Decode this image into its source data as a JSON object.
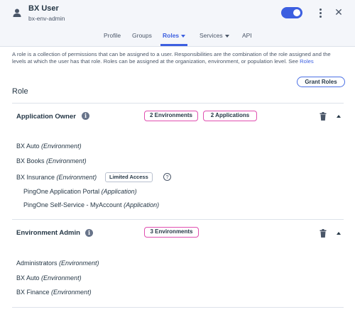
{
  "header": {
    "user_name": "BX User",
    "user_sub": "bx-env-admin",
    "enabled": true
  },
  "tabs": [
    {
      "label": "Profile",
      "active": false,
      "dropdown": false
    },
    {
      "label": "Groups",
      "active": false,
      "dropdown": false
    },
    {
      "label": "Roles",
      "active": true,
      "dropdown": true
    },
    {
      "label": "Services",
      "active": false,
      "dropdown": true
    },
    {
      "label": "API",
      "active": false,
      "dropdown": false
    }
  ],
  "description": {
    "text": "A role is a collection of permissions that can be assigned to a user. Responsibilities are the combination of the role assigned and the levels at which the user has that role. Roles can be assigned at the organization, environment, or population level. See ",
    "link": "Roles"
  },
  "grant_roles_label": "Grant Roles",
  "section_title": "Role",
  "roles": [
    {
      "name": "Application Owner",
      "badges": [
        "2 Environments",
        "2 Applications"
      ],
      "items": [
        {
          "name": "BX Auto",
          "scope": "(Environment)"
        },
        {
          "name": "BX Books",
          "scope": "(Environment)"
        },
        {
          "name": "BX Insurance",
          "scope": "(Environment)",
          "tag": "Limited Access"
        },
        {
          "name": "PingOne Application Portal",
          "scope": "(Application)"
        },
        {
          "name": "PingOne Self-Service - MyAccount",
          "scope": "(Application)"
        }
      ]
    },
    {
      "name": "Environment Admin",
      "badges": [
        "3 Environments"
      ],
      "items": [
        {
          "name": "Administrators",
          "scope": "(Environment)"
        },
        {
          "name": "BX Auto",
          "scope": "(Environment)"
        },
        {
          "name": "BX Finance",
          "scope": "(Environment)"
        }
      ]
    }
  ],
  "icons": {
    "user": "user-icon",
    "toggle": "toggle-switch",
    "kebab": "more-vertical-icon",
    "close": "close-icon",
    "info": "info-icon",
    "trash": "trash-icon",
    "collapse": "chevron-up-icon",
    "help": "help-icon"
  },
  "colors": {
    "accent": "#3c5fe0",
    "badge_border": "#e04fb0",
    "text": "#253746",
    "header_bg": "#f4f6fa"
  }
}
